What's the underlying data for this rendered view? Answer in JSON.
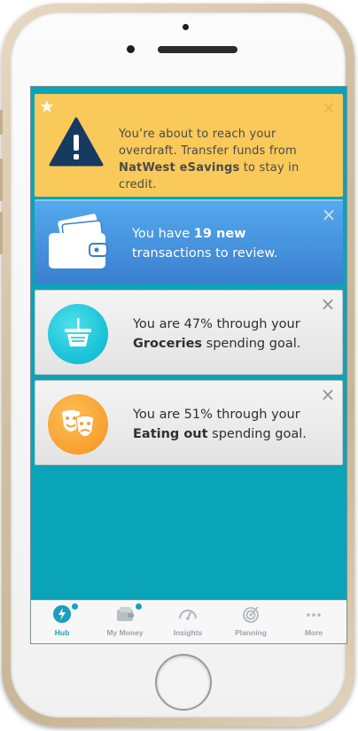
{
  "alerts": {
    "overdraft": {
      "line1": "You’re about to reach your",
      "line2": "overdraft. Transfer funds from",
      "account": "NatWest eSavings",
      "line3_rest": " to stay in credit.",
      "close": "×"
    },
    "transactions": {
      "prefix": "You have ",
      "count": "19 new",
      "suffix": "transactions to review.",
      "close": "×"
    },
    "groceries": {
      "line1": "You are 47% through your",
      "goal": "Groceries",
      "suffix": " spending goal.",
      "close": "×"
    },
    "eating_out": {
      "line1": "You are 51% through your",
      "goal": "Eating out",
      "suffix": " spending goal.",
      "close": "×"
    }
  },
  "tabbar": {
    "tabs": [
      {
        "label": "Hub",
        "icon": "lightning-icon",
        "active": true
      },
      {
        "label": "My Money",
        "icon": "wallet-icon",
        "active": false
      },
      {
        "label": "Insights",
        "icon": "gauge-icon",
        "active": false
      },
      {
        "label": "Planning",
        "icon": "target-icon",
        "active": false
      },
      {
        "label": "More",
        "icon": "more-icon",
        "active": false
      }
    ]
  },
  "colors": {
    "screen_bg": "#0aa4b8",
    "warning_card": "#f9c95a",
    "info_card": "#3a7fd0",
    "accent": "#1a9fc0"
  }
}
